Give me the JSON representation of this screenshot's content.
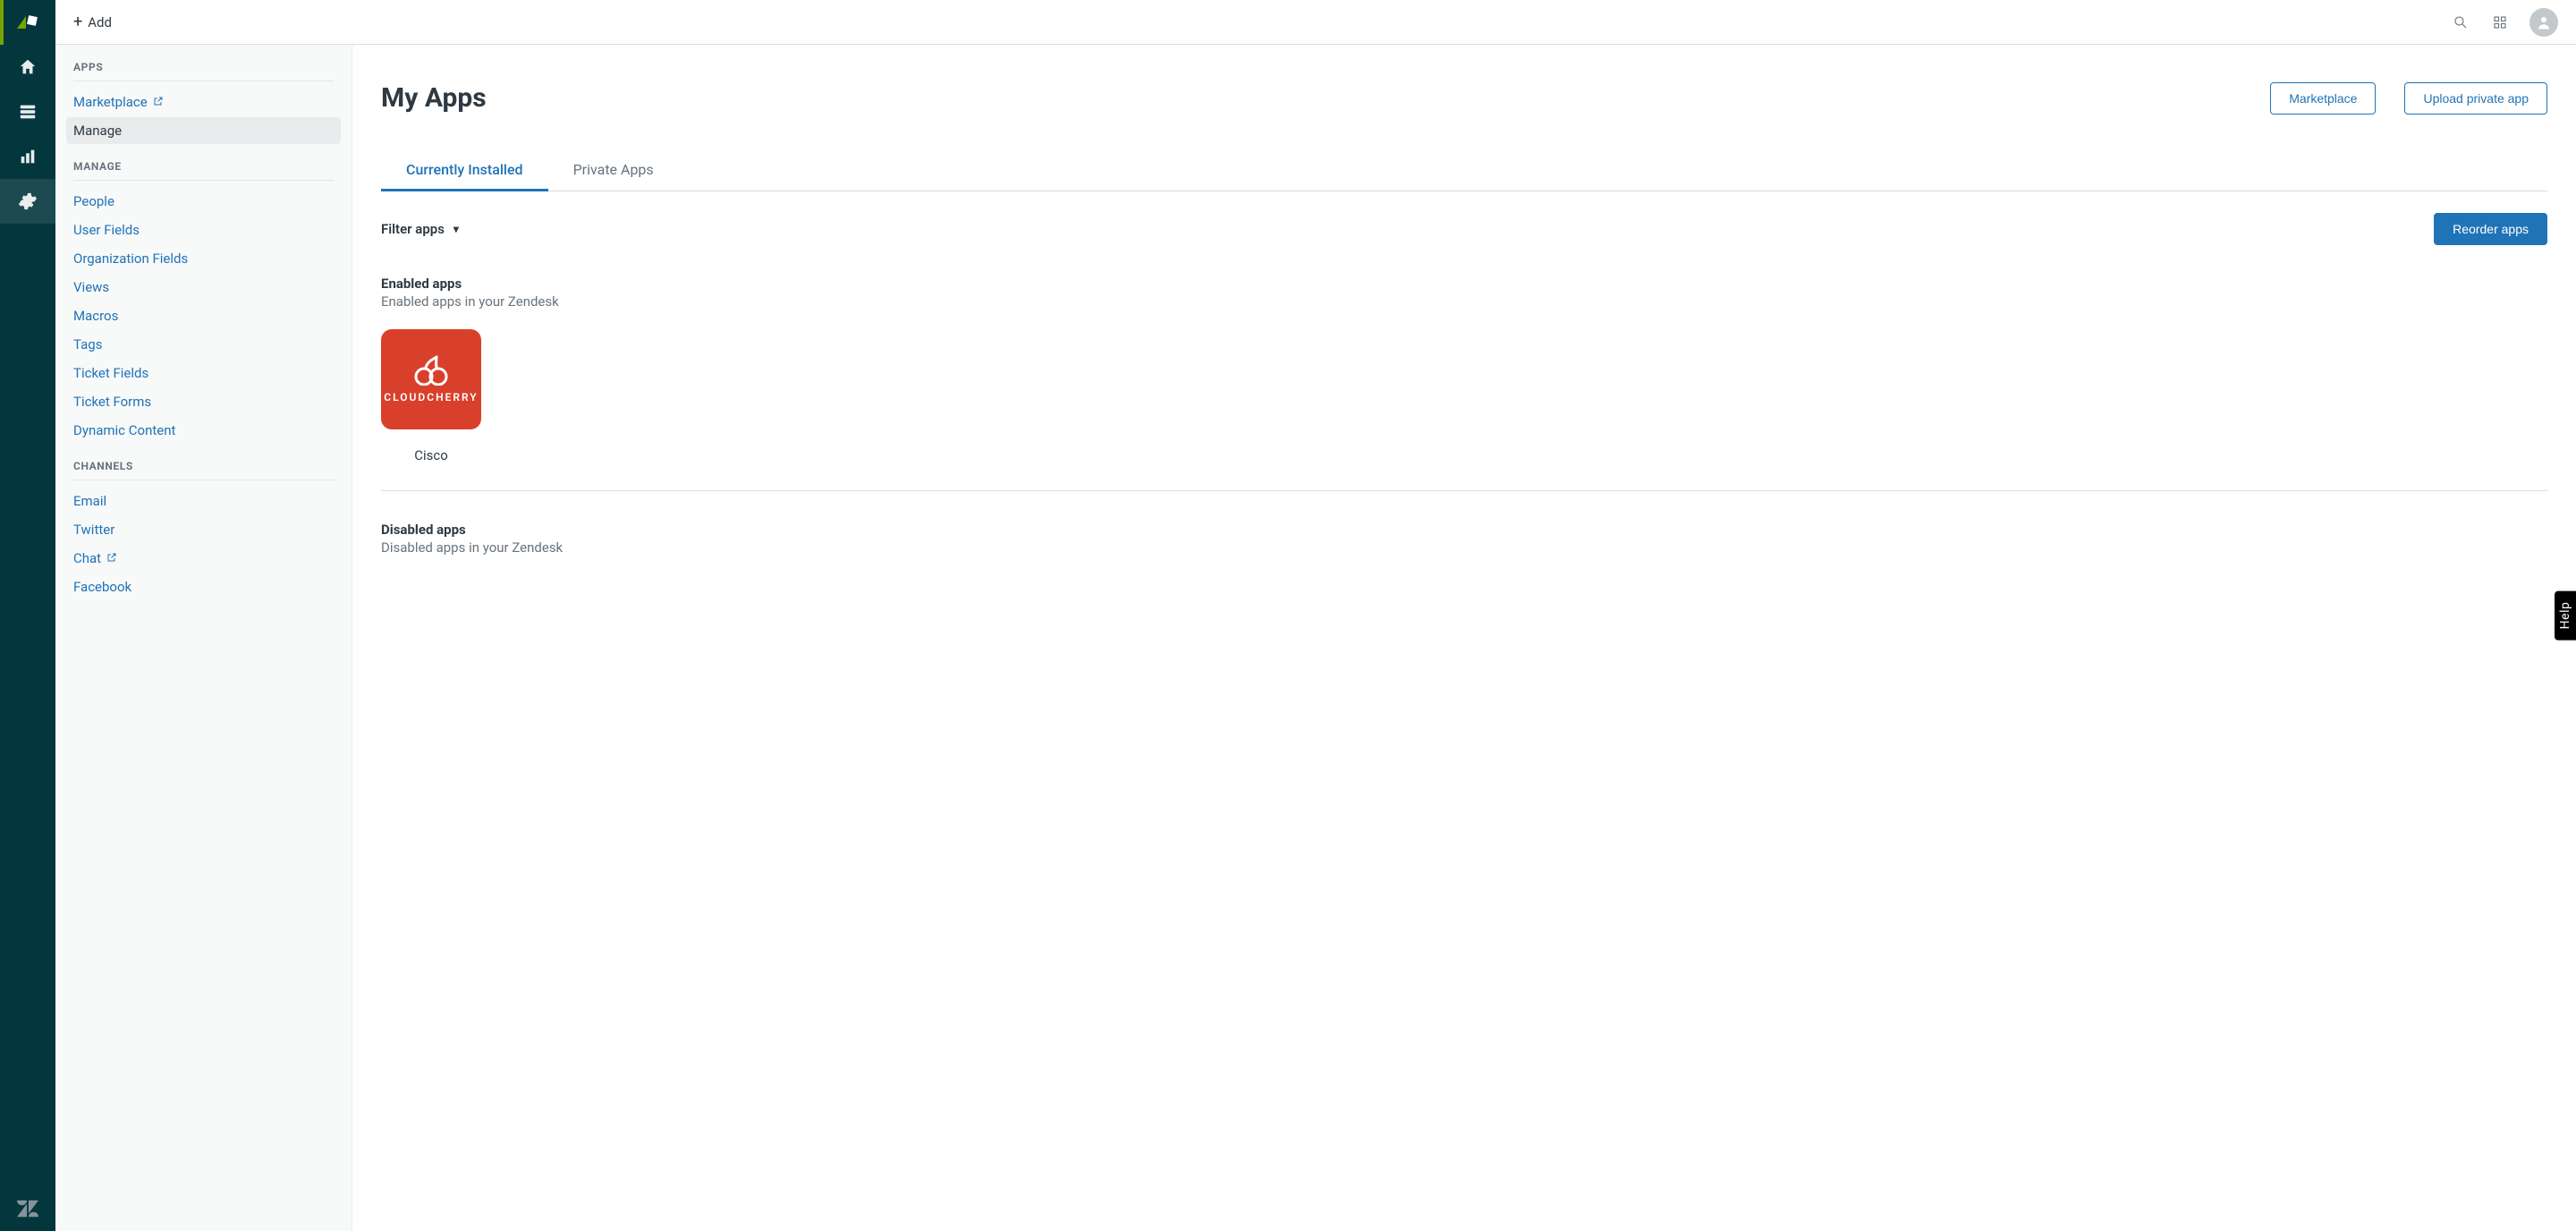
{
  "topbar": {
    "add_label": "Add"
  },
  "rail": {
    "items": [
      "home",
      "views",
      "reporting",
      "admin"
    ],
    "active_index": 3
  },
  "sidebar": {
    "sections": [
      {
        "title": "APPS",
        "items": [
          {
            "label": "Marketplace",
            "external": true
          },
          {
            "label": "Manage",
            "active": true
          }
        ]
      },
      {
        "title": "MANAGE",
        "items": [
          {
            "label": "People"
          },
          {
            "label": "User Fields"
          },
          {
            "label": "Organization Fields"
          },
          {
            "label": "Views"
          },
          {
            "label": "Macros"
          },
          {
            "label": "Tags"
          },
          {
            "label": "Ticket Fields"
          },
          {
            "label": "Ticket Forms"
          },
          {
            "label": "Dynamic Content"
          }
        ]
      },
      {
        "title": "CHANNELS",
        "items": [
          {
            "label": "Email"
          },
          {
            "label": "Twitter"
          },
          {
            "label": "Chat",
            "external": true
          },
          {
            "label": "Facebook"
          }
        ]
      }
    ]
  },
  "panel": {
    "title": "My Apps",
    "buttons": {
      "marketplace": "Marketplace",
      "upload": "Upload private app",
      "reorder": "Reorder apps"
    },
    "tabs": [
      {
        "label": "Currently Installed",
        "active": true
      },
      {
        "label": "Private Apps"
      }
    ],
    "filter_label": "Filter apps",
    "enabled": {
      "heading": "Enabled apps",
      "sub": "Enabled apps in your Zendesk",
      "apps": [
        {
          "name": "Cisco",
          "tile_brand": "CLOUDCHERRY"
        }
      ]
    },
    "disabled": {
      "heading": "Disabled apps",
      "sub": "Disabled apps in your Zendesk"
    }
  },
  "help_tab": "Help"
}
